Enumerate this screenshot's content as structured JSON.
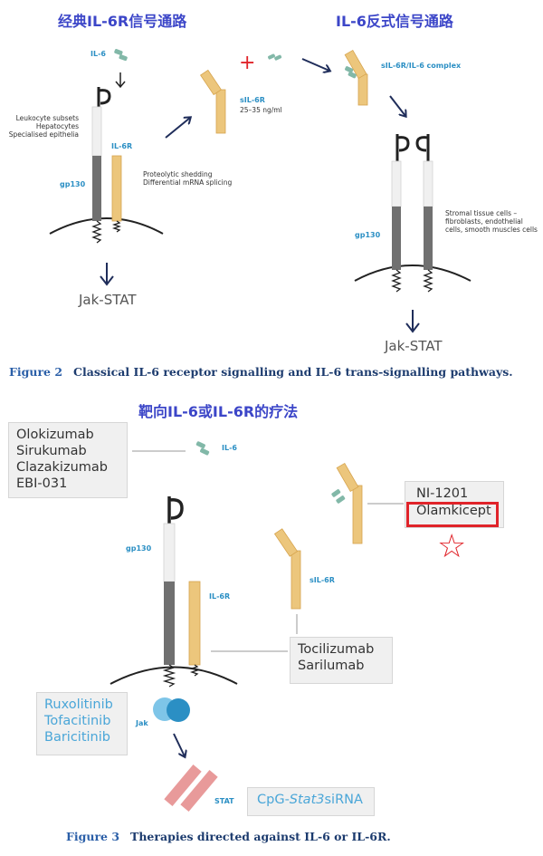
{
  "figure2": {
    "title_classic": "经典IL-6R信号通路",
    "title_trans": "IL-6反式信号通路",
    "labels": {
      "il6": "IL-6",
      "cell_types": [
        "Leukocyte subsets",
        "Hepatocytes",
        "Specialised epithelia"
      ],
      "il6r": "IL-6R",
      "gp130_left": "gp130",
      "shedding": [
        "Proteolytic shedding",
        "Differential mRNA splicing"
      ],
      "sil6r": "sIL-6R",
      "sil6r_conc": "25–35 ng/ml",
      "complex": "sIL-6R/IL-6 complex",
      "stromal": [
        "Stromal tissue cells –",
        "fibroblasts, endothelial",
        "cells, smooth muscles cells"
      ],
      "gp130_right": "gp130",
      "jak_left": "Jak-STAT",
      "jak_right": "Jak-STAT"
    },
    "caption_num": "Figure 2",
    "caption_text": "Classical IL-6 receptor signalling and IL-6 trans-signalling pathways."
  },
  "figure3": {
    "title": "靶向IL-6或IL-6R的疗法",
    "il6_antibodies": [
      "Olokizumab",
      "Sirukumab",
      "Clazakizumab",
      "EBI-031"
    ],
    "il6_label": "IL-6",
    "trans_inhibitors": [
      "NI-1201",
      "Olamkicept"
    ],
    "gp130": "gp130",
    "sil6r": "sIL-6R",
    "il6r": "IL-6R",
    "il6r_antibodies": [
      "Tocilizumab",
      "Sarilumab"
    ],
    "jak_inhibitors": [
      "Ruxolitinib",
      "Tofacitinib",
      "Baricitinib"
    ],
    "jak_label": "Jak",
    "stat_label": "STAT",
    "stat3": {
      "prefix": "CpG-",
      "italic": "Stat3",
      "suffix": "siRNA"
    },
    "caption_num": "Figure 3",
    "caption_text": "Therapies directed against IL-6 or IL-6R."
  },
  "annotations": {
    "highlighted_drug": "Olamkicept",
    "star_glyph": "☆",
    "highlight_color": "#e0242a"
  }
}
